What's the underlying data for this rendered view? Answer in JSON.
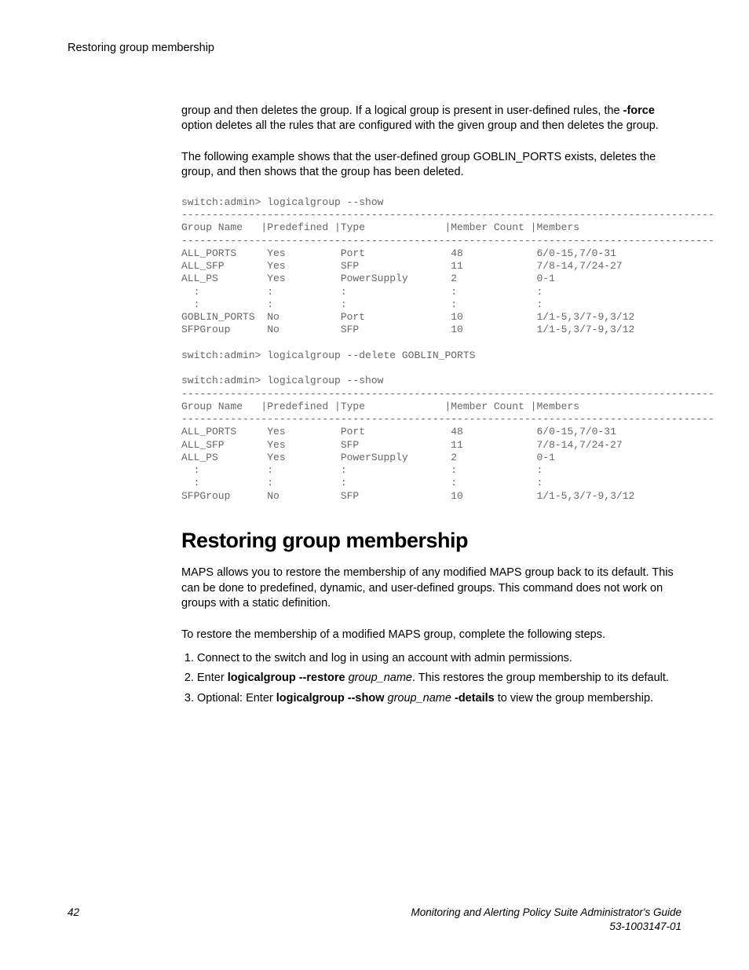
{
  "header": {
    "running": "Restoring group membership"
  },
  "intro": {
    "p1a": "group and then deletes the group. If a logical group is present in user-defined rules, the ",
    "p1b": "-force",
    "p1c": " option deletes all the rules that are configured with the given group and then deletes the group.",
    "p2": "The following example shows that the user-defined group GOBLIN_PORTS exists, deletes the group, and then shows that the group has been deleted."
  },
  "code": "switch:admin> logicalgroup --show\n---------------------------------------------------------------------------------------\nGroup Name   |Predefined |Type             |Member Count |Members\n---------------------------------------------------------------------------------------\nALL_PORTS     Yes         Port              48            6/0-15,7/0-31\nALL_SFP       Yes         SFP               11            7/8-14,7/24-27\nALL_PS        Yes         PowerSupply       2             0-1\n  :           :           :                 :             :\n  :           :           :                 :             :\nGOBLIN_PORTS  No          Port              10            1/1-5,3/7-9,3/12\nSFPGroup      No          SFP               10            1/1-5,3/7-9,3/12\n\nswitch:admin> logicalgroup --delete GOBLIN_PORTS\n\nswitch:admin> logicalgroup --show\n---------------------------------------------------------------------------------------\nGroup Name   |Predefined |Type             |Member Count |Members\n---------------------------------------------------------------------------------------\nALL_PORTS     Yes         Port              48            6/0-15,7/0-31\nALL_SFP       Yes         SFP               11            7/8-14,7/24-27\nALL_PS        Yes         PowerSupply       2             0-1\n  :           :           :                 :             :\n  :           :           :                 :             :\nSFPGroup      No          SFP               10            1/1-5,3/7-9,3/12",
  "section": {
    "title": "Restoring group membership",
    "p1": "MAPS allows you to restore the membership of any modified MAPS group back to its default. This can be done to predefined, dynamic, and user-defined groups. This command does not work on groups with a static definition.",
    "p2": "To restore the membership of a modified MAPS group, complete the following steps.",
    "step1": "Connect to the switch and log in using an account with admin permissions.",
    "step2a": "Enter ",
    "step2b": "logicalgroup --restore",
    "step2c": " group_name",
    "step2d": ". This restores the group membership to its default.",
    "step3a": "Optional: Enter ",
    "step3b": "logicalgroup --show",
    "step3c": " group_name ",
    "step3d": "-details",
    "step3e": " to view the group membership."
  },
  "footer": {
    "page": "42",
    "title": "Monitoring and Alerting Policy Suite Administrator's Guide",
    "docnum": "53-1003147-01"
  }
}
